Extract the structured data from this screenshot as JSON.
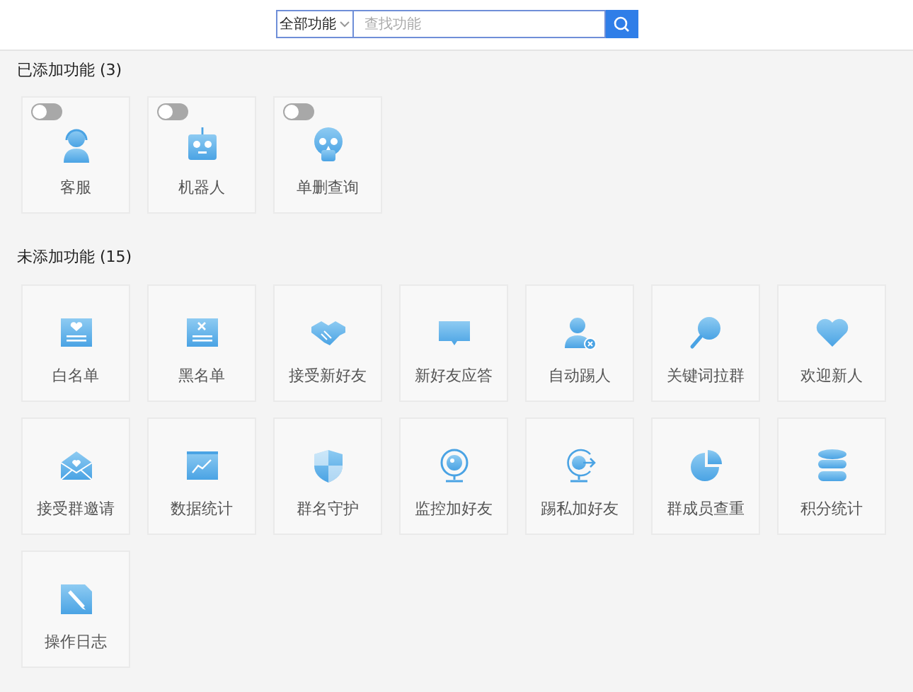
{
  "search": {
    "scope": "全部功能",
    "placeholder": "查找功能"
  },
  "added": {
    "heading": "已添加功能 (3)",
    "items": [
      {
        "label": "客服",
        "on": false
      },
      {
        "label": "机器人",
        "on": false
      },
      {
        "label": "单删查询",
        "on": false
      }
    ]
  },
  "not_added": {
    "heading": "未添加功能 (15)",
    "items": [
      {
        "label": "白名单"
      },
      {
        "label": "黑名单"
      },
      {
        "label": "接受新好友"
      },
      {
        "label": "新好友应答"
      },
      {
        "label": "自动踢人"
      },
      {
        "label": "关键词拉群"
      },
      {
        "label": "欢迎新人"
      },
      {
        "label": "接受群邀请"
      },
      {
        "label": "数据统计"
      },
      {
        "label": "群名守护"
      },
      {
        "label": "监控加好友"
      },
      {
        "label": "踢私加好友"
      },
      {
        "label": "群成员查重"
      },
      {
        "label": "积分统计"
      },
      {
        "label": "操作日志"
      }
    ]
  }
}
